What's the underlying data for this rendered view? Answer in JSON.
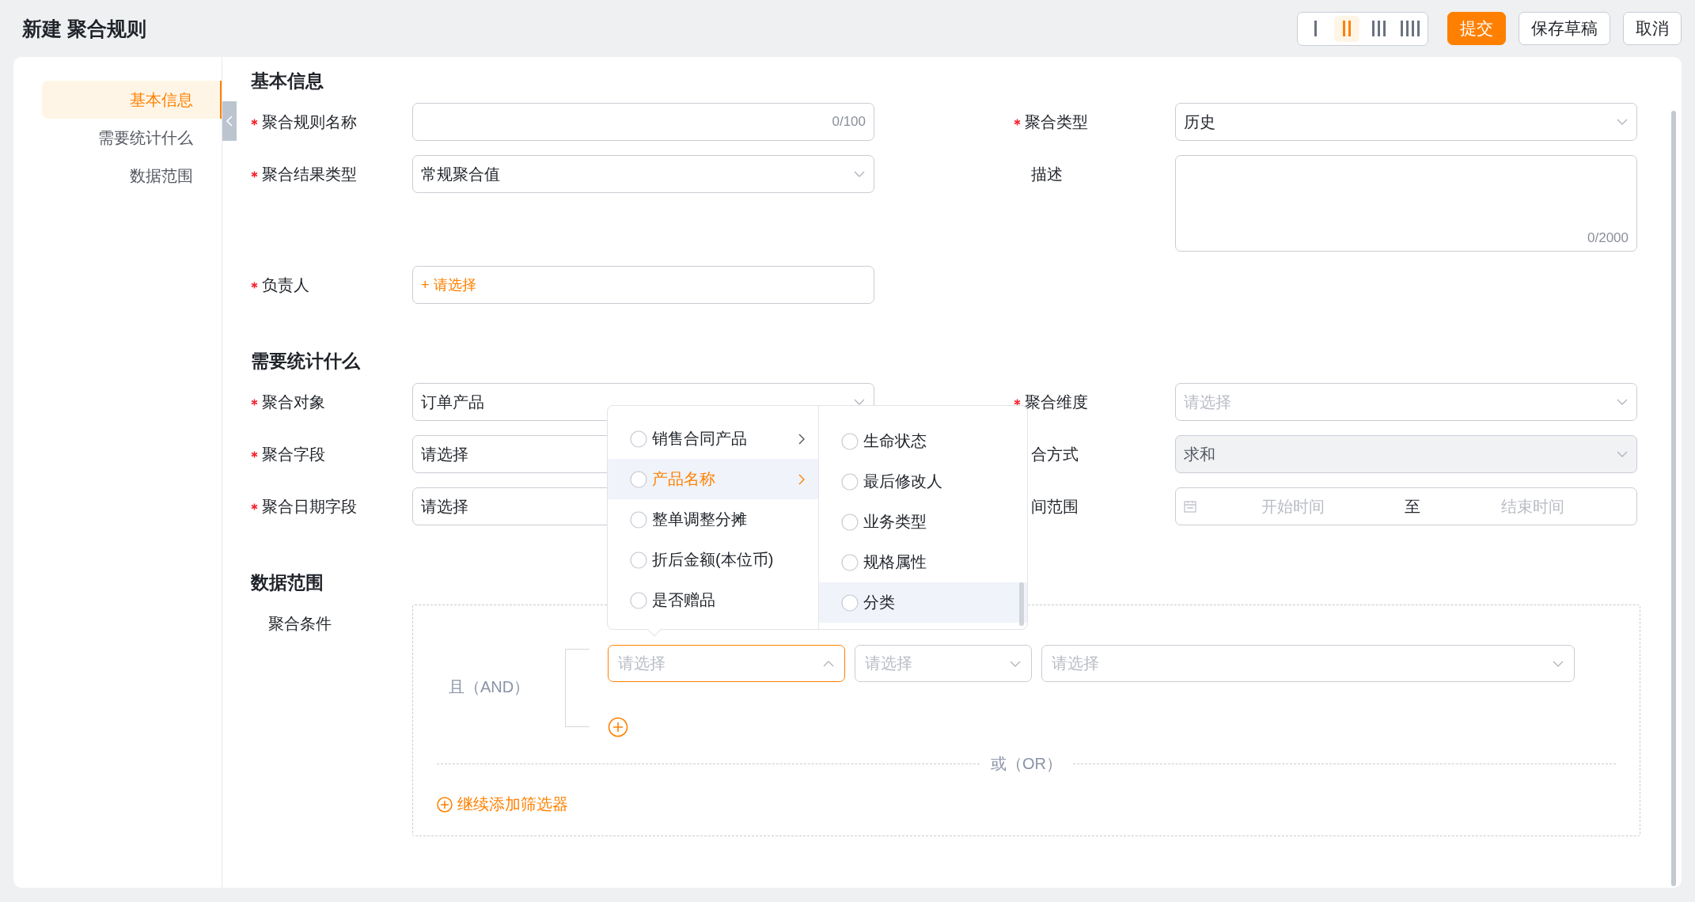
{
  "header": {
    "title": "新建 聚合规则",
    "layout_options": [
      {
        "selected": false
      },
      {
        "selected": true
      },
      {
        "selected": false
      },
      {
        "selected": false
      }
    ],
    "buttons": [
      {
        "label": "提交",
        "kind": "primary"
      },
      {
        "label": "保存草稿",
        "kind": "default"
      },
      {
        "label": "取消",
        "kind": "default"
      }
    ]
  },
  "nav": {
    "items": [
      {
        "label": "基本信息",
        "selected": true
      },
      {
        "label": "需要统计什么",
        "selected": false
      },
      {
        "label": "数据范围",
        "selected": false
      }
    ]
  },
  "sections": [
    {
      "title": "基本信息",
      "fields": [
        {
          "label": "聚合规则名称",
          "required": true,
          "kind": "input",
          "counter": "0/100"
        },
        {
          "label": "聚合类型",
          "required": true,
          "kind": "select",
          "value": "历史"
        },
        {
          "label": "聚合结果类型",
          "required": true,
          "kind": "select",
          "value": "常规聚合值"
        },
        {
          "label": "描述",
          "required": false,
          "kind": "textarea",
          "counter": "0/2000"
        },
        {
          "label": "负责人",
          "required": true,
          "kind": "picker",
          "value": "+ 请选择"
        }
      ]
    },
    {
      "title": "需要统计什么",
      "fields": [
        {
          "label": "聚合对象",
          "required": true,
          "kind": "select",
          "value": "订单产品"
        },
        {
          "label": "聚合维度",
          "required": true,
          "kind": "select",
          "placeholder": "请选择"
        },
        {
          "label": "聚合字段",
          "required": true,
          "kind": "select",
          "value": "请选择"
        },
        {
          "label": "合方式",
          "required": false,
          "kind": "select",
          "value": "求和",
          "disabled": true
        },
        {
          "label": "聚合日期字段",
          "required": true,
          "kind": "select",
          "value": "请选择"
        },
        {
          "label": "间范围",
          "required": false,
          "kind": "daterange",
          "start": "开始时间",
          "separator": "至",
          "end": "结束时间"
        }
      ]
    },
    {
      "title": "数据范围",
      "conditions": {
        "label": "聚合条件",
        "group_label": "且（AND）",
        "filters": [
          {
            "placeholder": "请选择",
            "open": true
          },
          {
            "placeholder": "请选择",
            "open": false
          },
          {
            "placeholder": "请选择",
            "open": false
          }
        ],
        "or_label": "或（OR）",
        "add_label": "继续添加筛选器",
        "dropdown": {
          "left": [
            {
              "label": "销售合同产品",
              "has_children": true,
              "highlighted": false
            },
            {
              "label": "产品名称",
              "has_children": true,
              "highlighted": true
            },
            {
              "label": "整单调整分摊",
              "has_children": false,
              "highlighted": false
            },
            {
              "label": "折后金额(本位币)",
              "has_children": false,
              "highlighted": false
            },
            {
              "label": "是否赠品",
              "has_children": false,
              "highlighted": false
            }
          ],
          "right": [
            {
              "label": "生命状态",
              "highlighted": false
            },
            {
              "label": "最后修改人",
              "highlighted": false
            },
            {
              "label": "业务类型",
              "highlighted": false
            },
            {
              "label": "规格属性",
              "highlighted": false
            },
            {
              "label": "分类",
              "highlighted": true
            }
          ]
        }
      }
    }
  ]
}
